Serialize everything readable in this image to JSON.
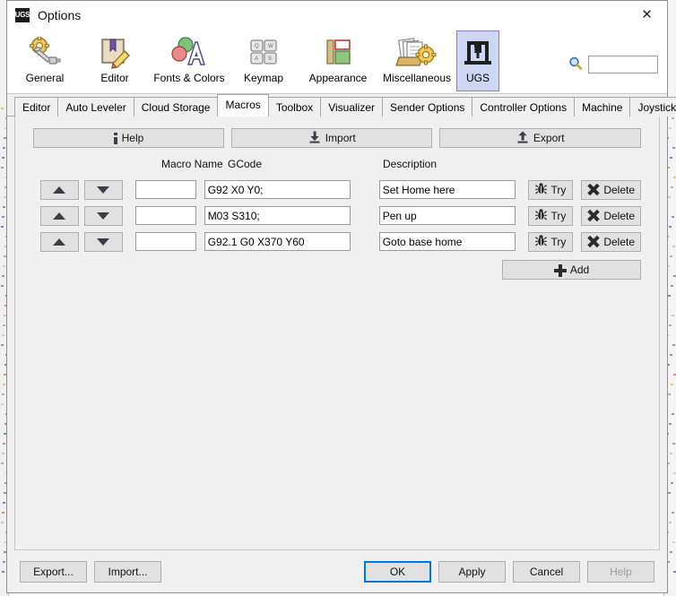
{
  "window": {
    "title": "Options",
    "app_badge": "UGS",
    "close_label": "✕"
  },
  "search": {
    "icon": "search-icon",
    "value": "",
    "placeholder": ""
  },
  "categories": [
    {
      "label": "General",
      "icon": "gear-wrench-icon",
      "selected": false
    },
    {
      "label": "Editor",
      "icon": "book-pencil-icon",
      "selected": false
    },
    {
      "label": "Fonts & Colors",
      "icon": "fonts-colors-icon",
      "selected": false
    },
    {
      "label": "Keymap",
      "icon": "keyboard-keys-icon",
      "selected": false
    },
    {
      "label": "Appearance",
      "icon": "layout-panels-icon",
      "selected": false
    },
    {
      "label": "Miscellaneous",
      "icon": "papers-gear-icon",
      "selected": false
    },
    {
      "label": "UGS",
      "icon": "ugs-machine-icon",
      "selected": true
    }
  ],
  "tabs": [
    {
      "label": "Editor",
      "active": false
    },
    {
      "label": "Auto Leveler",
      "active": false
    },
    {
      "label": "Cloud Storage",
      "active": false
    },
    {
      "label": "Macros",
      "active": true
    },
    {
      "label": "Toolbox",
      "active": false
    },
    {
      "label": "Visualizer",
      "active": false
    },
    {
      "label": "Sender Options",
      "active": false
    },
    {
      "label": "Controller Options",
      "active": false
    },
    {
      "label": "Machine",
      "active": false
    },
    {
      "label": "Joystick",
      "active": false
    }
  ],
  "macros_panel": {
    "toolbar": {
      "help_label": "Help",
      "import_label": "Import",
      "export_label": "Export"
    },
    "columns": {
      "macro_name": "Macro Name",
      "gcode": "GCode",
      "description": "Description"
    },
    "row_buttons": {
      "move_up": "▲",
      "move_down": "▼",
      "try_label": "Try",
      "delete_label": "Delete"
    },
    "add_label": "Add",
    "rows": [
      {
        "name": "",
        "gcode": "G92 X0 Y0;",
        "description": "Set Home here"
      },
      {
        "name": "",
        "gcode": "M03 S310;",
        "description": "Pen up"
      },
      {
        "name": "",
        "gcode": "G92.1 G0 X370 Y60",
        "description": "Goto base home"
      }
    ]
  },
  "footer": {
    "export_label": "Export...",
    "import_label": "Import...",
    "ok_label": "OK",
    "apply_label": "Apply",
    "cancel_label": "Cancel",
    "help_label": "Help"
  },
  "colors": {
    "dialog_bg": "#f0f0f0",
    "selected_category": "#cdd6f2",
    "selected_category_border": "#8e7cc3",
    "focus_border": "#0078d7",
    "field_bg": "#ffffff",
    "button_bg": "#e1e1e1"
  }
}
